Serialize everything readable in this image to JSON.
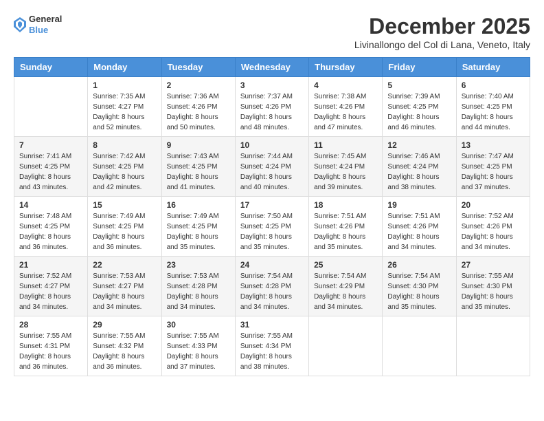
{
  "header": {
    "logo_general": "General",
    "logo_blue": "Blue",
    "month_title": "December 2025",
    "subtitle": "Livinallongo del Col di Lana, Veneto, Italy"
  },
  "days_of_week": [
    "Sunday",
    "Monday",
    "Tuesday",
    "Wednesday",
    "Thursday",
    "Friday",
    "Saturday"
  ],
  "weeks": [
    [
      {
        "day": "",
        "sunrise": "",
        "sunset": "",
        "daylight": ""
      },
      {
        "day": "1",
        "sunrise": "Sunrise: 7:35 AM",
        "sunset": "Sunset: 4:27 PM",
        "daylight": "Daylight: 8 hours and 52 minutes."
      },
      {
        "day": "2",
        "sunrise": "Sunrise: 7:36 AM",
        "sunset": "Sunset: 4:26 PM",
        "daylight": "Daylight: 8 hours and 50 minutes."
      },
      {
        "day": "3",
        "sunrise": "Sunrise: 7:37 AM",
        "sunset": "Sunset: 4:26 PM",
        "daylight": "Daylight: 8 hours and 48 minutes."
      },
      {
        "day": "4",
        "sunrise": "Sunrise: 7:38 AM",
        "sunset": "Sunset: 4:26 PM",
        "daylight": "Daylight: 8 hours and 47 minutes."
      },
      {
        "day": "5",
        "sunrise": "Sunrise: 7:39 AM",
        "sunset": "Sunset: 4:25 PM",
        "daylight": "Daylight: 8 hours and 46 minutes."
      },
      {
        "day": "6",
        "sunrise": "Sunrise: 7:40 AM",
        "sunset": "Sunset: 4:25 PM",
        "daylight": "Daylight: 8 hours and 44 minutes."
      }
    ],
    [
      {
        "day": "7",
        "sunrise": "Sunrise: 7:41 AM",
        "sunset": "Sunset: 4:25 PM",
        "daylight": "Daylight: 8 hours and 43 minutes."
      },
      {
        "day": "8",
        "sunrise": "Sunrise: 7:42 AM",
        "sunset": "Sunset: 4:25 PM",
        "daylight": "Daylight: 8 hours and 42 minutes."
      },
      {
        "day": "9",
        "sunrise": "Sunrise: 7:43 AM",
        "sunset": "Sunset: 4:25 PM",
        "daylight": "Daylight: 8 hours and 41 minutes."
      },
      {
        "day": "10",
        "sunrise": "Sunrise: 7:44 AM",
        "sunset": "Sunset: 4:24 PM",
        "daylight": "Daylight: 8 hours and 40 minutes."
      },
      {
        "day": "11",
        "sunrise": "Sunrise: 7:45 AM",
        "sunset": "Sunset: 4:24 PM",
        "daylight": "Daylight: 8 hours and 39 minutes."
      },
      {
        "day": "12",
        "sunrise": "Sunrise: 7:46 AM",
        "sunset": "Sunset: 4:24 PM",
        "daylight": "Daylight: 8 hours and 38 minutes."
      },
      {
        "day": "13",
        "sunrise": "Sunrise: 7:47 AM",
        "sunset": "Sunset: 4:25 PM",
        "daylight": "Daylight: 8 hours and 37 minutes."
      }
    ],
    [
      {
        "day": "14",
        "sunrise": "Sunrise: 7:48 AM",
        "sunset": "Sunset: 4:25 PM",
        "daylight": "Daylight: 8 hours and 36 minutes."
      },
      {
        "day": "15",
        "sunrise": "Sunrise: 7:49 AM",
        "sunset": "Sunset: 4:25 PM",
        "daylight": "Daylight: 8 hours and 36 minutes."
      },
      {
        "day": "16",
        "sunrise": "Sunrise: 7:49 AM",
        "sunset": "Sunset: 4:25 PM",
        "daylight": "Daylight: 8 hours and 35 minutes."
      },
      {
        "day": "17",
        "sunrise": "Sunrise: 7:50 AM",
        "sunset": "Sunset: 4:25 PM",
        "daylight": "Daylight: 8 hours and 35 minutes."
      },
      {
        "day": "18",
        "sunrise": "Sunrise: 7:51 AM",
        "sunset": "Sunset: 4:26 PM",
        "daylight": "Daylight: 8 hours and 35 minutes."
      },
      {
        "day": "19",
        "sunrise": "Sunrise: 7:51 AM",
        "sunset": "Sunset: 4:26 PM",
        "daylight": "Daylight: 8 hours and 34 minutes."
      },
      {
        "day": "20",
        "sunrise": "Sunrise: 7:52 AM",
        "sunset": "Sunset: 4:26 PM",
        "daylight": "Daylight: 8 hours and 34 minutes."
      }
    ],
    [
      {
        "day": "21",
        "sunrise": "Sunrise: 7:52 AM",
        "sunset": "Sunset: 4:27 PM",
        "daylight": "Daylight: 8 hours and 34 minutes."
      },
      {
        "day": "22",
        "sunrise": "Sunrise: 7:53 AM",
        "sunset": "Sunset: 4:27 PM",
        "daylight": "Daylight: 8 hours and 34 minutes."
      },
      {
        "day": "23",
        "sunrise": "Sunrise: 7:53 AM",
        "sunset": "Sunset: 4:28 PM",
        "daylight": "Daylight: 8 hours and 34 minutes."
      },
      {
        "day": "24",
        "sunrise": "Sunrise: 7:54 AM",
        "sunset": "Sunset: 4:28 PM",
        "daylight": "Daylight: 8 hours and 34 minutes."
      },
      {
        "day": "25",
        "sunrise": "Sunrise: 7:54 AM",
        "sunset": "Sunset: 4:29 PM",
        "daylight": "Daylight: 8 hours and 34 minutes."
      },
      {
        "day": "26",
        "sunrise": "Sunrise: 7:54 AM",
        "sunset": "Sunset: 4:30 PM",
        "daylight": "Daylight: 8 hours and 35 minutes."
      },
      {
        "day": "27",
        "sunrise": "Sunrise: 7:55 AM",
        "sunset": "Sunset: 4:30 PM",
        "daylight": "Daylight: 8 hours and 35 minutes."
      }
    ],
    [
      {
        "day": "28",
        "sunrise": "Sunrise: 7:55 AM",
        "sunset": "Sunset: 4:31 PM",
        "daylight": "Daylight: 8 hours and 36 minutes."
      },
      {
        "day": "29",
        "sunrise": "Sunrise: 7:55 AM",
        "sunset": "Sunset: 4:32 PM",
        "daylight": "Daylight: 8 hours and 36 minutes."
      },
      {
        "day": "30",
        "sunrise": "Sunrise: 7:55 AM",
        "sunset": "Sunset: 4:33 PM",
        "daylight": "Daylight: 8 hours and 37 minutes."
      },
      {
        "day": "31",
        "sunrise": "Sunrise: 7:55 AM",
        "sunset": "Sunset: 4:34 PM",
        "daylight": "Daylight: 8 hours and 38 minutes."
      },
      {
        "day": "",
        "sunrise": "",
        "sunset": "",
        "daylight": ""
      },
      {
        "day": "",
        "sunrise": "",
        "sunset": "",
        "daylight": ""
      },
      {
        "day": "",
        "sunrise": "",
        "sunset": "",
        "daylight": ""
      }
    ]
  ]
}
